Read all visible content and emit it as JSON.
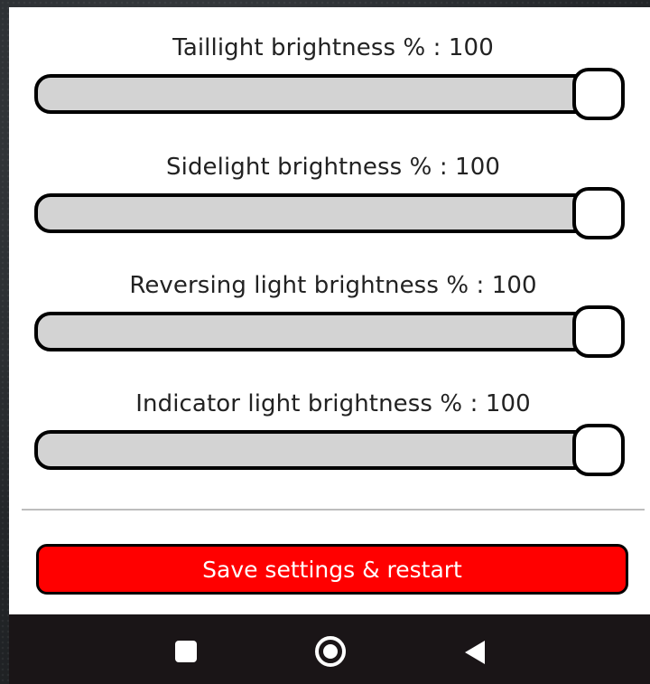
{
  "settings": [
    {
      "label": "Taillight brightness % : 100",
      "value": 100,
      "max": 100
    },
    {
      "label": "Sidelight brightness % : 100",
      "value": 100,
      "max": 100
    },
    {
      "label": "Reversing light brightness % : 100",
      "value": 100,
      "max": 100
    },
    {
      "label": "Indicator light brightness % : 100",
      "value": 100,
      "max": 100
    }
  ],
  "save_button": {
    "label": "Save settings & restart"
  },
  "navbar": {
    "recents_icon": "square-icon",
    "home_icon": "circle-home-icon",
    "back_icon": "triangle-back-icon"
  },
  "colors": {
    "panel_background": "#ffffff",
    "slider_track": "#d3d3d3",
    "slider_border": "#000000",
    "save_button": "#ff0000",
    "navbar": "#1a1517"
  }
}
